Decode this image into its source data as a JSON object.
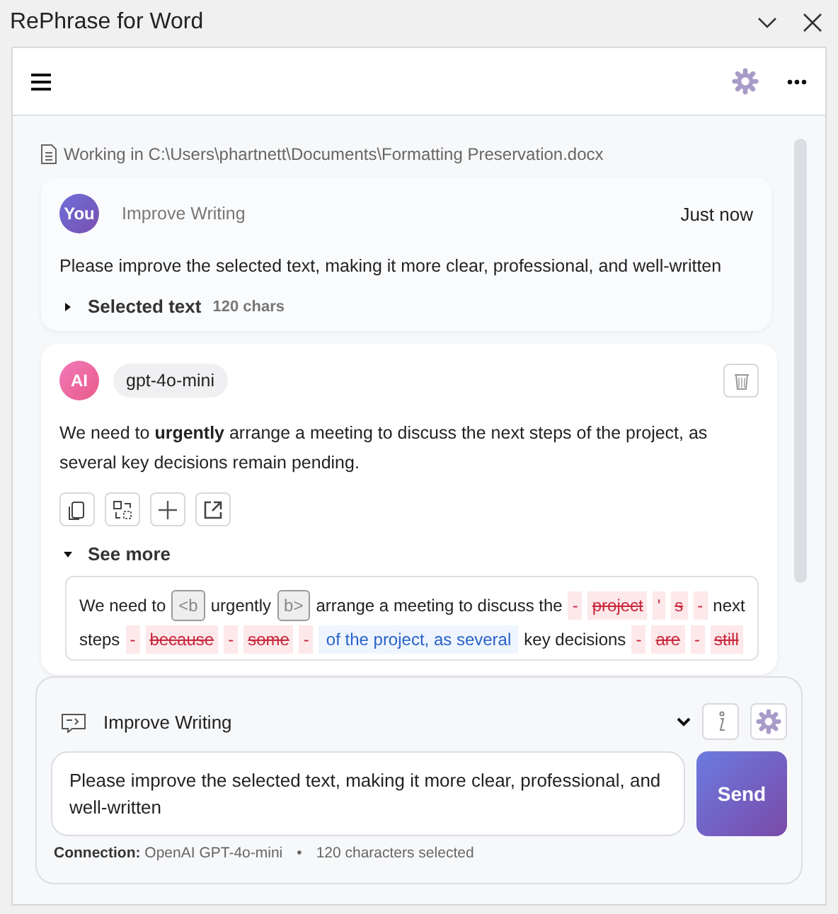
{
  "window": {
    "title": "RePhrase for Word"
  },
  "document": {
    "label": "Working in C:\\Users\\phartnett\\Documents\\Formatting Preservation.docx"
  },
  "messages": [
    {
      "kind": "user",
      "avatar": "You",
      "action": "Improve Writing",
      "time": "Just now",
      "text": "Please improve the selected text, making it more clear, professional, and well-written",
      "details": {
        "label": "Selected text",
        "count": "120 chars",
        "expanded": false
      }
    },
    {
      "kind": "assistant",
      "avatar": "AI",
      "model": "gpt-4o-mini",
      "text": "We need to **urgently** arrange a meeting to discuss the next steps of the project, as several key decisions remain pending.",
      "details": {
        "label": "See more",
        "expanded": true
      },
      "diff": [
        [
          {
            "kind": "text",
            "text": "We need to"
          },
          {
            "kind": "tag",
            "text": "<b"
          },
          {
            "kind": "text",
            "text": "urgently"
          },
          {
            "kind": "tag",
            "text": "b>"
          },
          {
            "kind": "text",
            "text": "arrange a meeting to discuss the"
          },
          {
            "kind": "mark",
            "text": "-"
          },
          {
            "kind": "del",
            "text": "project"
          },
          {
            "kind": "mark",
            "text": "'"
          },
          {
            "kind": "del",
            "text": "s"
          },
          {
            "kind": "mark",
            "text": "-"
          },
          {
            "kind": "text",
            "text": "next"
          }
        ],
        [
          {
            "kind": "text",
            "text": "steps"
          },
          {
            "kind": "mark",
            "text": "-"
          },
          {
            "kind": "del",
            "text": "because"
          },
          {
            "kind": "mark",
            "text": "-"
          },
          {
            "kind": "del",
            "text": "some"
          },
          {
            "kind": "mark",
            "text": "-"
          },
          {
            "kind": "ins",
            "text": "of the project, as several"
          },
          {
            "kind": "text",
            "text": "key decisions"
          },
          {
            "kind": "mark",
            "text": "-"
          },
          {
            "kind": "del",
            "text": "are"
          },
          {
            "kind": "mark",
            "text": "-"
          },
          {
            "kind": "del",
            "text": "still"
          }
        ]
      ]
    }
  ],
  "composer": {
    "preset": "Improve Writing",
    "value": "Please improve the selected text, making it more clear, professional, and well-written",
    "send": "Send",
    "connection": "**Connection:** OpenAI GPT-4o-mini",
    "separator": "•",
    "selection": "120 characters selected"
  }
}
